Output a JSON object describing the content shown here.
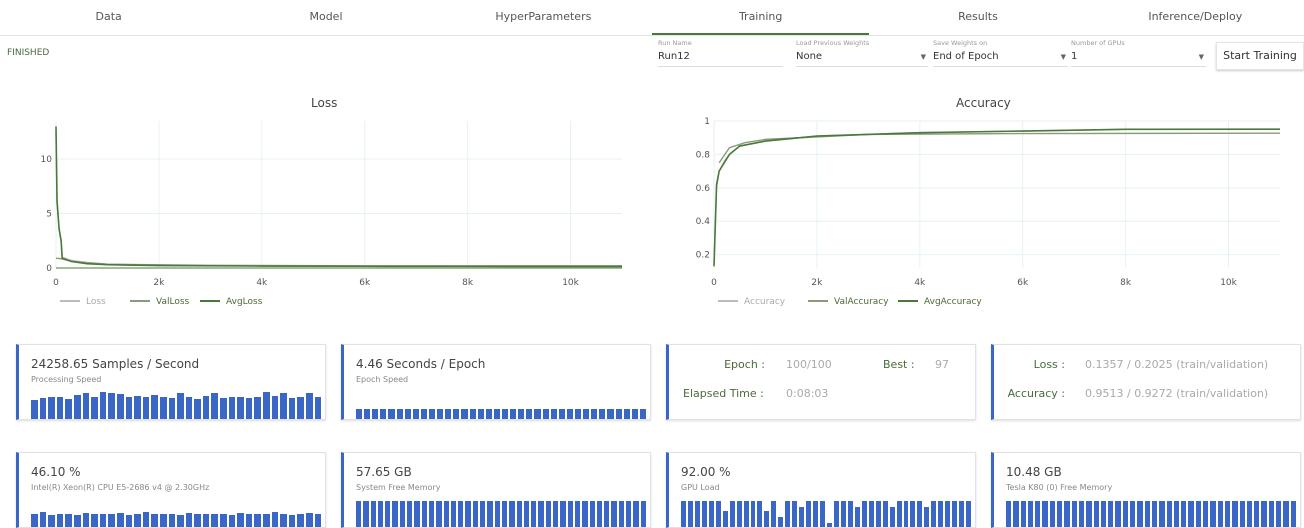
{
  "tabs": [
    "Data",
    "Model",
    "HyperParameters",
    "Training",
    "Results",
    "Inference/Deploy"
  ],
  "active_tab": 3,
  "status": "FINISHED",
  "fields": {
    "run_name": {
      "label": "Run Name",
      "value": "Run12"
    },
    "load_weights": {
      "label": "Load Previous Weights",
      "value": "None"
    },
    "save_weights": {
      "label": "Save Weights on",
      "value": "End of Epoch"
    },
    "gpus": {
      "label": "Number of GPUs",
      "value": "1"
    }
  },
  "start_button": "Start Training",
  "chart_data": [
    {
      "type": "line",
      "title": "Loss",
      "xlim": [
        0,
        11000
      ],
      "ylim": [
        0,
        13.5
      ],
      "xticks": [
        0,
        2000,
        4000,
        6000,
        8000,
        10000
      ],
      "xtick_labels": [
        "0",
        "2k",
        "4k",
        "6k",
        "8k",
        "10k"
      ],
      "yticks": [
        0,
        5,
        10
      ],
      "ytick_labels": [
        "0",
        "5",
        "10"
      ],
      "legend": "bottom-left",
      "series": [
        {
          "name": "Loss",
          "color": "#bbbbbb",
          "x": [
            0,
            20,
            60,
            100,
            120,
            300,
            600,
            1000,
            2000,
            4000,
            6000,
            8000,
            11000
          ],
          "y": [
            12.5,
            6,
            3.5,
            2.4,
            1.0,
            0.7,
            0.5,
            0.35,
            0.25,
            0.2,
            0.17,
            0.16,
            0.15
          ]
        },
        {
          "name": "ValLoss",
          "color": "#8a9a7a",
          "x": [
            0,
            100,
            300,
            1000,
            3000,
            6000,
            11000
          ],
          "y": [
            0.9,
            0.85,
            0.6,
            0.35,
            0.25,
            0.2,
            0.2
          ]
        },
        {
          "name": "AvgLoss",
          "color": "#4a7a3a",
          "x": [
            0,
            20,
            60,
            100,
            120,
            300,
            600,
            1000,
            2000,
            4000,
            6000,
            8000,
            11000
          ],
          "y": [
            13,
            6.2,
            3.6,
            2.5,
            0.9,
            0.6,
            0.4,
            0.3,
            0.22,
            0.18,
            0.16,
            0.15,
            0.14
          ]
        }
      ]
    },
    {
      "type": "line",
      "title": "Accuracy",
      "xlim": [
        0,
        11000
      ],
      "ylim": [
        0.12,
        1.0
      ],
      "xticks": [
        0,
        2000,
        4000,
        6000,
        8000,
        10000
      ],
      "xtick_labels": [
        "0",
        "2k",
        "4k",
        "6k",
        "8k",
        "10k"
      ],
      "yticks": [
        0.2,
        0.4,
        0.6,
        0.8,
        1
      ],
      "ytick_labels": [
        "0.2",
        "0.4",
        "0.6",
        "0.8",
        "1"
      ],
      "legend": "bottom-left",
      "series": [
        {
          "name": "Accuracy",
          "color": "#bbbbbb",
          "x": [
            0,
            50,
            100,
            200,
            300,
            500,
            1000,
            2000,
            4000,
            6000,
            8000,
            11000
          ],
          "y": [
            0.15,
            0.6,
            0.7,
            0.76,
            0.8,
            0.85,
            0.88,
            0.91,
            0.93,
            0.94,
            0.95,
            0.95
          ]
        },
        {
          "name": "ValAccuracy",
          "color": "#8a9a7a",
          "x": [
            100,
            300,
            600,
            1000,
            3000,
            6000,
            11000
          ],
          "y": [
            0.75,
            0.84,
            0.87,
            0.89,
            0.92,
            0.925,
            0.927
          ]
        },
        {
          "name": "AvgAccuracy",
          "color": "#4a7a3a",
          "x": [
            0,
            50,
            100,
            200,
            300,
            500,
            1000,
            2000,
            4000,
            6000,
            8000,
            11000
          ],
          "y": [
            0.13,
            0.62,
            0.7,
            0.75,
            0.8,
            0.85,
            0.88,
            0.91,
            0.93,
            0.94,
            0.95,
            0.951
          ]
        }
      ]
    }
  ],
  "cards_row1": [
    {
      "value": "24258.65 Samples / Second",
      "label": "Processing Speed",
      "spark": [
        0.6,
        0.65,
        0.7,
        0.68,
        0.62,
        0.75,
        0.8,
        0.7,
        0.85,
        0.8,
        0.78,
        0.7,
        0.72,
        0.68,
        0.75,
        0.7,
        0.65,
        0.8,
        0.7,
        0.62,
        0.72,
        0.8,
        0.65,
        0.7,
        0.68,
        0.66,
        0.7,
        0.85,
        0.72,
        0.8,
        0.65,
        0.7,
        0.82,
        0.68
      ]
    },
    {
      "value": "4.46 Seconds / Epoch",
      "label": "Epoch Speed",
      "spark": [
        0.3,
        0.3,
        0.3,
        0.3,
        0.3,
        0.3,
        0.3,
        0.3,
        0.3,
        0.3,
        0.3,
        0.3,
        0.3,
        0.3,
        0.3,
        0.3,
        0.3,
        0.3,
        0.3,
        0.3,
        0.3,
        0.3,
        0.3,
        0.3,
        0.3,
        0.3,
        0.3,
        0.3,
        0.3,
        0.3,
        0.3,
        0.3,
        0.3,
        0.3,
        0.3,
        0.3
      ]
    }
  ],
  "epoch_card": {
    "epoch_label": "Epoch :",
    "epoch_value": "100/100",
    "best_label": "Best :",
    "best_value": "97",
    "elapsed_label": "Elapsed Time :",
    "elapsed_value": "0:08:03"
  },
  "metrics_card": {
    "loss_label": "Loss :",
    "loss_value": "0.1357 / 0.2025 (train/validation)",
    "acc_label": "Accuracy :",
    "acc_value": "0.9513 / 0.9272 (train/validation)"
  },
  "cards_row2": [
    {
      "value": "46.10 %",
      "label": "Intel(R) Xeon(R) CPU E5-2686 v4 @ 2.30GHz",
      "spark": [
        0.6,
        0.65,
        0.55,
        0.6,
        0.6,
        0.55,
        0.62,
        0.6,
        0.58,
        0.6,
        0.62,
        0.55,
        0.6,
        0.65,
        0.6,
        0.58,
        0.6,
        0.55,
        0.62,
        0.6,
        0.58,
        0.6,
        0.6,
        0.55,
        0.62,
        0.6,
        0.6,
        0.58,
        0.65,
        0.6,
        0.55,
        0.6,
        0.62,
        0.6
      ]
    },
    {
      "value": "57.65 GB",
      "label": "System Free Memory",
      "spark": [
        1,
        1,
        1,
        1,
        1,
        1,
        1,
        1,
        1,
        1,
        1,
        1,
        1,
        1,
        1,
        1,
        1,
        1,
        1,
        1,
        1,
        1,
        1,
        1,
        1,
        1,
        1,
        1,
        1,
        1,
        1,
        1,
        1,
        1,
        1,
        1,
        1,
        1,
        1,
        1
      ]
    },
    {
      "value": "92.00 %",
      "label": "GPU Load",
      "spark": [
        1,
        1,
        1,
        1,
        1,
        1,
        0.7,
        1,
        1,
        1,
        1,
        1,
        0.7,
        1,
        0.5,
        1,
        1,
        0.8,
        1,
        1,
        1,
        0.3,
        1,
        1,
        1,
        0.8,
        1,
        1,
        1,
        1,
        0.8,
        1,
        1,
        1,
        1,
        0.8,
        1,
        1,
        1,
        1,
        1,
        1
      ]
    },
    {
      "value": "10.48 GB",
      "label": "Tesla K80 (0) Free Memory",
      "spark": [
        1,
        1,
        1,
        1,
        1,
        1,
        1,
        1,
        1,
        1,
        1,
        1,
        1,
        1,
        1,
        1,
        1,
        1,
        1,
        1,
        1,
        1,
        1,
        1,
        1,
        1,
        1,
        1,
        1,
        1,
        1,
        1,
        1,
        1,
        1,
        1,
        1,
        1,
        1,
        1
      ]
    }
  ]
}
